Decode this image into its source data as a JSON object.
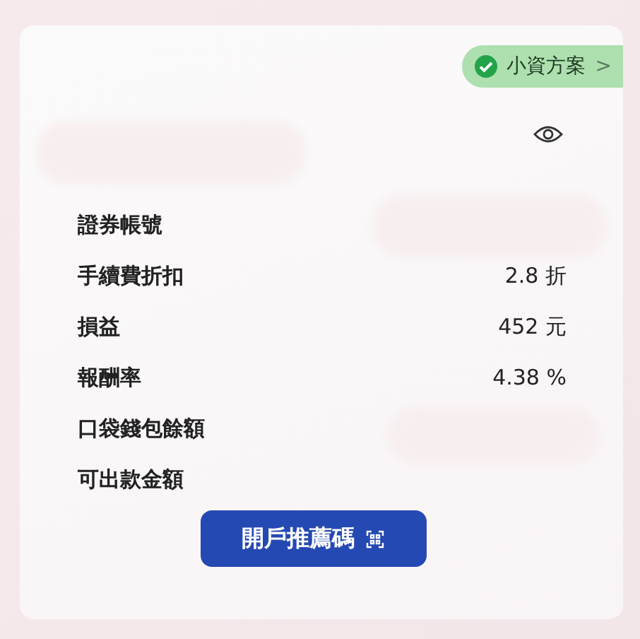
{
  "badge": {
    "label": "小資方案",
    "checked": true,
    "chevron": ">"
  },
  "rows": [
    {
      "label": "證券帳號"
    },
    {
      "label": "手續費折扣",
      "value": "2.8 折"
    },
    {
      "label": "損益",
      "value": "452 元"
    },
    {
      "label": "報酬率",
      "value": "4.38 %"
    },
    {
      "label": "口袋錢包餘額"
    },
    {
      "label": "可出款金額"
    }
  ],
  "button": {
    "label": "開戶推薦碼"
  }
}
